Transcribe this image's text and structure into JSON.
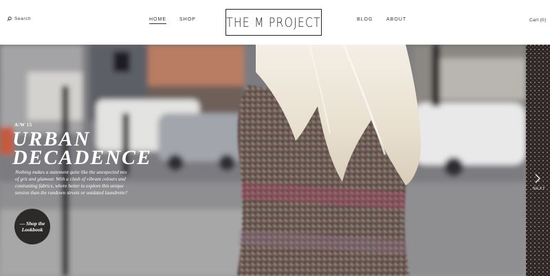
{
  "header": {
    "search_label": "Search",
    "nav": {
      "home": "HOME",
      "shop": "SHOP",
      "blog": "BLOG",
      "about": "ABOUT"
    },
    "logo_text": "THE M PROJECT",
    "cart": "Cart (0)"
  },
  "hero": {
    "season": "A/W 15",
    "headline_line1": "URBAN",
    "headline_line2": "DECADENCE",
    "body": "Nothing makes a statement quite like the unexpected mix of grit and glamour. With a clash of vibrant colours and contrasting fabrics, where better to explore this unique tension than the rundown streets or outdated laundrette?",
    "cta": "— Shop the Lookbook"
  },
  "slider": {
    "next_label": "NEXT",
    "next_icon": "chevron-right-icon"
  },
  "colors": {
    "cta_background": "#2c2a29",
    "text_on_image": "#ffffff",
    "header_background": "#ffffff"
  }
}
